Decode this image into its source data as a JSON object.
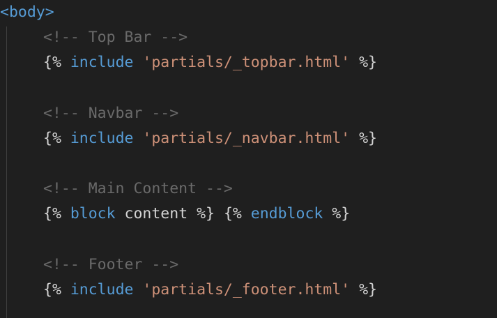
{
  "code": {
    "body_tag": "<body>",
    "comment_topbar": "<!-- Top Bar -->",
    "comment_navbar": "<!-- Navbar -->",
    "comment_main": "<!-- Main Content -->",
    "comment_footer": "<!-- Footer -->",
    "open": "{%",
    "close": "%}",
    "include_kw": "include",
    "block_kw": "block",
    "block_name": "content",
    "endblock_kw": "endblock",
    "topbar_path": "'partials/_topbar.html'",
    "navbar_path": "'partials/_navbar.html'",
    "footer_path": "'partials/_footer.html'"
  },
  "colors": {
    "background": "#1f1f1f",
    "tag": "#569cd6",
    "comment": "#6a6a6a",
    "keyword": "#569cd6",
    "string": "#ce9178",
    "text": "#d4d4d4"
  }
}
